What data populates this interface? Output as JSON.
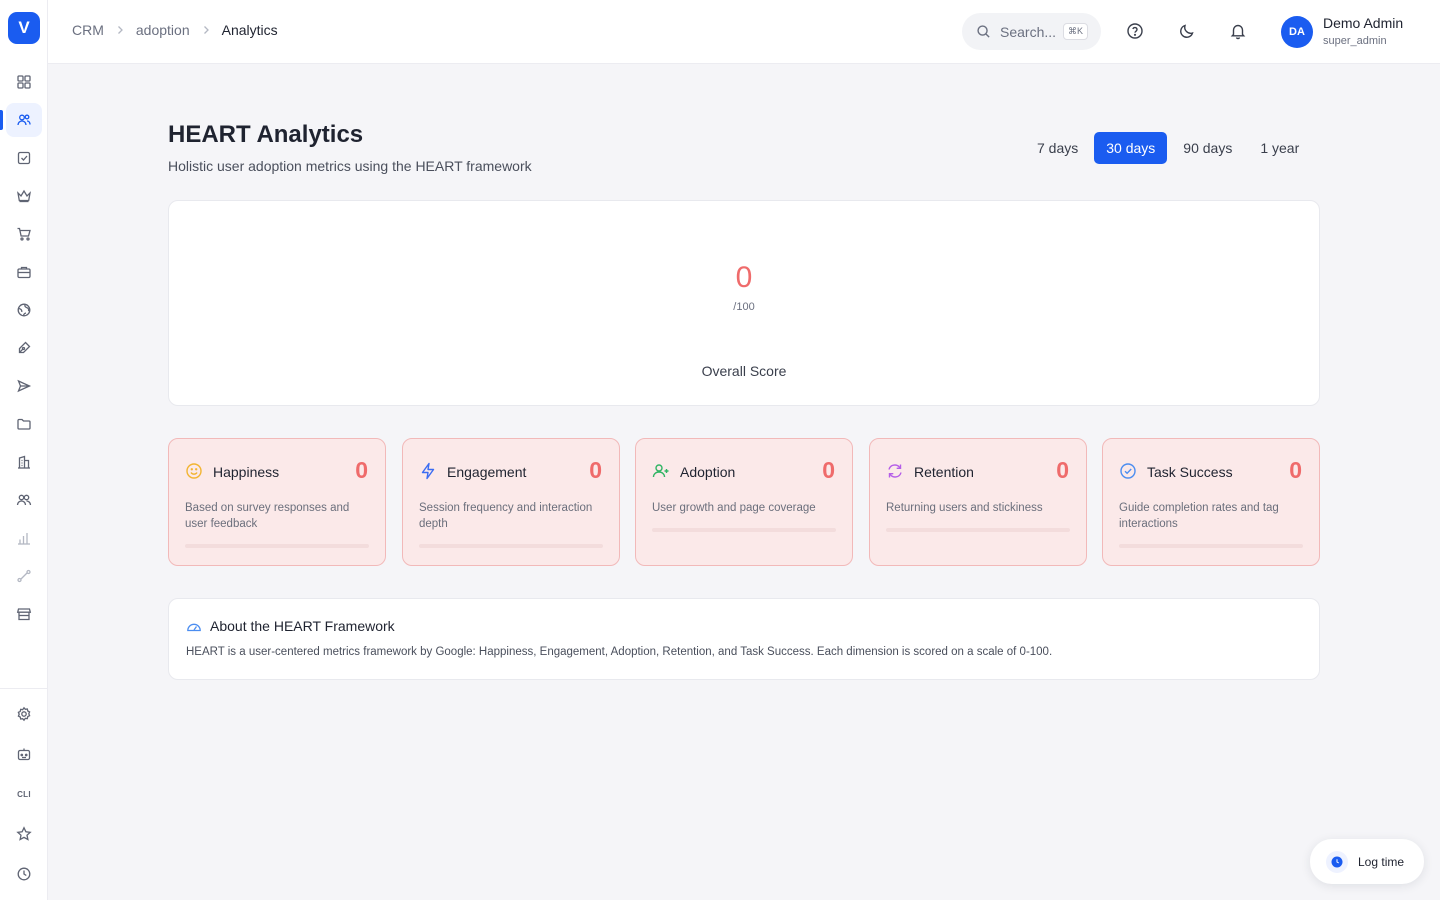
{
  "app": {
    "logo_letter": "V"
  },
  "breadcrumb": [
    {
      "label": "CRM"
    },
    {
      "label": "adoption"
    },
    {
      "label": "Analytics"
    }
  ],
  "search": {
    "placeholder": "Search...",
    "shortcut": "⌘K"
  },
  "user": {
    "initials": "DA",
    "name": "Demo Admin",
    "role": "super_admin"
  },
  "page": {
    "title": "HEART Analytics",
    "subtitle": "Holistic user adoption metrics using the HEART framework"
  },
  "ranges": [
    {
      "label": "7 days",
      "selected": false
    },
    {
      "label": "30 days",
      "selected": true
    },
    {
      "label": "90 days",
      "selected": false
    },
    {
      "label": "1 year",
      "selected": false
    }
  ],
  "overall": {
    "value": "0",
    "max": "/100",
    "label": "Overall Score"
  },
  "metrics": [
    {
      "name": "Happiness",
      "value": "0",
      "description": "Based on survey responses and user feedback",
      "icon": "smile-icon",
      "icon_color": "#f2b431",
      "progress": 0
    },
    {
      "name": "Engagement",
      "value": "0",
      "description": "Session frequency and interaction depth",
      "icon": "zap-icon",
      "icon_color": "#3b6cf2",
      "progress": 0
    },
    {
      "name": "Adoption",
      "value": "0",
      "description": "User growth and page coverage",
      "icon": "user-plus-icon",
      "icon_color": "#2fb463",
      "progress": 0
    },
    {
      "name": "Retention",
      "value": "0",
      "description": "Returning users and stickiness",
      "icon": "refresh-icon",
      "icon_color": "#b55ee8",
      "progress": 0
    },
    {
      "name": "Task Success",
      "value": "0",
      "description": "Guide completion rates and tag interactions",
      "icon": "check-circle-icon",
      "icon_color": "#4b8df0",
      "progress": 0
    }
  ],
  "about": {
    "title": "About the HEART Framework",
    "text": "HEART is a user-centered metrics framework by Google: Happiness, Engagement, Adoption, Retention, and Task Success. Each dimension is scored on a scale of 0-100."
  },
  "sidebar": {
    "cli_label": "CLI"
  },
  "log_time": {
    "label": "Log time"
  },
  "colors": {
    "accent": "#1a5cf0",
    "score_red": "#ef6b6b",
    "card_pink": "#fbe9e9"
  }
}
